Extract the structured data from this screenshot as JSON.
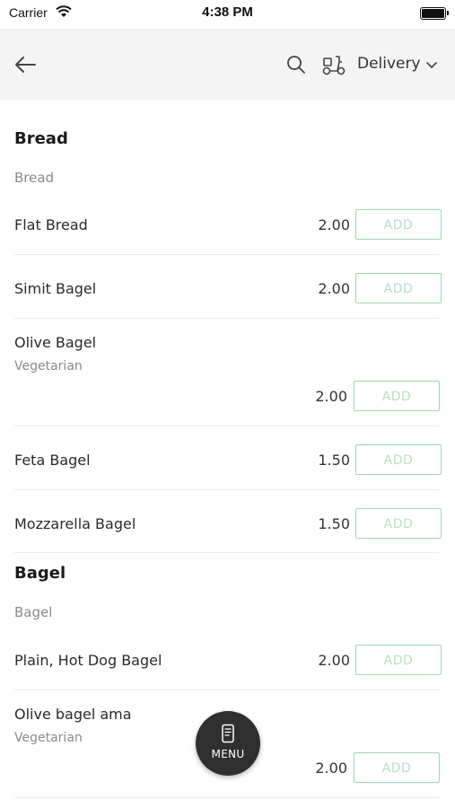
{
  "status_bar": {
    "carrier": "Carrier",
    "time": "4:38 PM"
  },
  "header": {
    "order_mode": "Delivery"
  },
  "sections": [
    {
      "title": "Bread",
      "subtitle": "Bread",
      "items": [
        {
          "name": "Flat Bread",
          "tag": "",
          "price": "2.00",
          "action": "ADD"
        },
        {
          "name": "Simit Bagel",
          "tag": "",
          "price": "2.00",
          "action": "ADD"
        },
        {
          "name": "Olive Bagel",
          "tag": "Vegetarian",
          "price": "2.00",
          "action": "ADD"
        },
        {
          "name": "Feta Bagel",
          "tag": "",
          "price": "1.50",
          "action": "ADD"
        },
        {
          "name": "Mozzarella Bagel",
          "tag": "",
          "price": "1.50",
          "action": "ADD"
        }
      ]
    },
    {
      "title": "Bagel",
      "subtitle": "Bagel",
      "items": [
        {
          "name": "Plain, Hot Dog Bagel",
          "tag": "",
          "price": "2.00",
          "action": "ADD"
        },
        {
          "name": "Olive bagel ama",
          "tag": "Vegetarian",
          "price": "2.00",
          "action": "ADD"
        }
      ]
    }
  ],
  "menu_button": {
    "label": "MENU"
  }
}
